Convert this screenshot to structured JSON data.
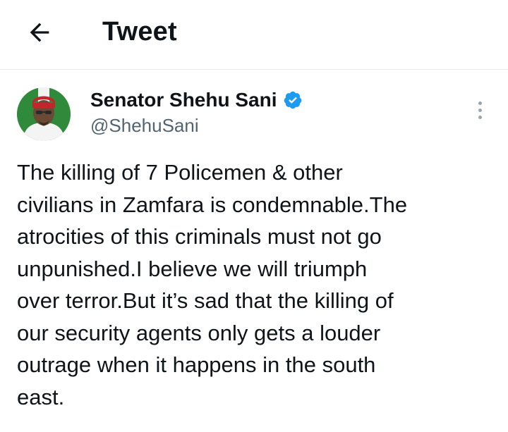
{
  "header": {
    "title": "Tweet",
    "back_icon": "arrow-left-icon"
  },
  "author": {
    "name": "Senator Shehu Sani",
    "handle": "@ShehuSani",
    "verified": true,
    "verified_color": "#1d9bf0"
  },
  "tweet": {
    "lines": [
      "The killing of 7 Policemen & other",
      "civilians in Zamfara is condemnable.The",
      "atrocities of this criminals must not go",
      "unpunished.I believe we will triumph",
      "over terror.But it’s sad that the killing of",
      "our security agents only gets a louder",
      "outrage when it happens in the south",
      "east."
    ]
  },
  "icons": {
    "more": "more-vertical-icon",
    "verified": "verified-badge-icon"
  }
}
